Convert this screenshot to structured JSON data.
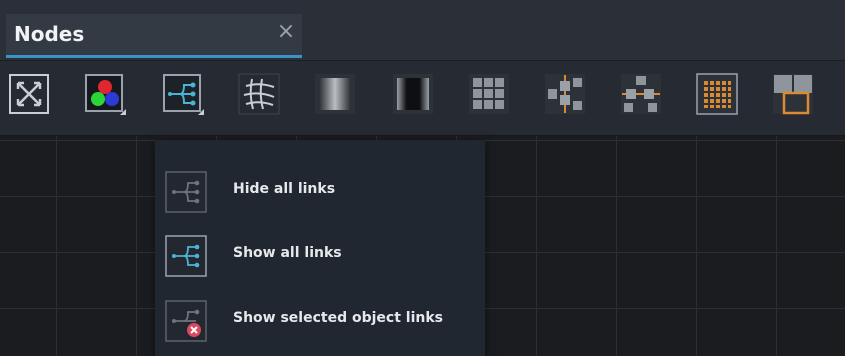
{
  "panel": {
    "title": "Nodes",
    "close_icon": "×"
  },
  "toolbar": {
    "tools": [
      {
        "icon": "fit-view-icon"
      },
      {
        "icon": "color-nodes-icon"
      },
      {
        "icon": "links-icon"
      },
      {
        "icon": "grid-warp-icon"
      },
      {
        "icon": "gradient-box-icon"
      },
      {
        "icon": "dark-gradient-box-icon"
      },
      {
        "icon": "grid-layout-icon"
      },
      {
        "icon": "horizontal-layout-icon"
      },
      {
        "icon": "vertical-layout-icon"
      },
      {
        "icon": "dot-matrix-icon"
      },
      {
        "icon": "group-frame-icon"
      }
    ]
  },
  "links_menu": {
    "items": [
      {
        "label": "Hide all links",
        "icon": "hide-links-icon"
      },
      {
        "label": "Show all links",
        "icon": "show-links-icon"
      },
      {
        "label": "Show selected object links",
        "icon": "selected-links-icon"
      }
    ]
  },
  "colors": {
    "accent": "#3a92c8",
    "node_orange": "#d98a32",
    "link_teal": "#4ab3d6",
    "remove_red": "#d9485f"
  }
}
